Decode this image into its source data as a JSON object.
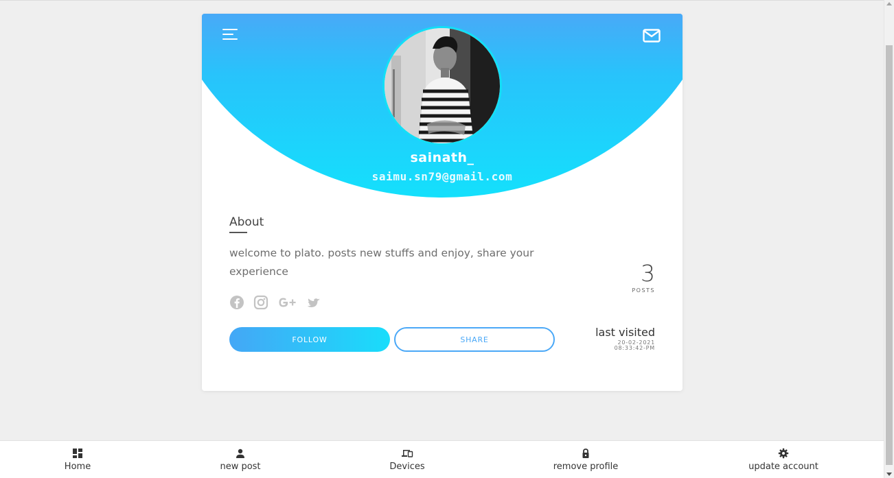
{
  "profile": {
    "username": "sainath_",
    "email": "saimu.sn79@gmail.com"
  },
  "about": {
    "title": "About",
    "text": "welcome to plato. posts new stuffs and enjoy, share your experience"
  },
  "social_icons": [
    "facebook-icon",
    "instagram-icon",
    "google-plus-icon",
    "twitter-icon"
  ],
  "buttons": {
    "follow_label": "FOLLOW",
    "share_label": "SHARE"
  },
  "stats": {
    "posts_count": "3",
    "posts_label": "POSTS"
  },
  "last_visited": {
    "title": "last visited",
    "date": "20-02-2021",
    "time": "08:33:42-PM"
  },
  "nav": {
    "items": [
      {
        "label": "Home",
        "icon": "dashboard-icon"
      },
      {
        "label": "new post",
        "icon": "person-icon"
      },
      {
        "label": "Devices",
        "icon": "devices-icon"
      },
      {
        "label": "remove profile",
        "icon": "lock-icon"
      },
      {
        "label": "update account",
        "icon": "gear-icon"
      }
    ]
  },
  "colors": {
    "accent_blue": "#4aa8f7",
    "accent_cyan": "#14e0fc",
    "background": "#efefef"
  }
}
